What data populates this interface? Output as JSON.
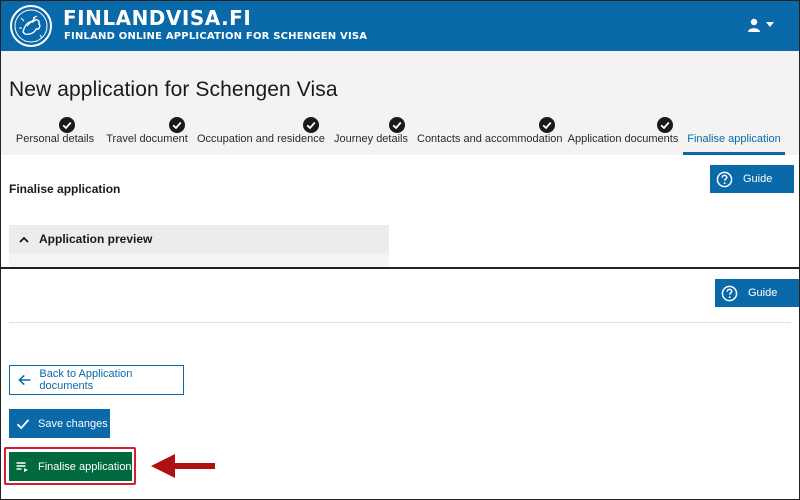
{
  "header": {
    "brand_title": "FINLANDVISA.FI",
    "brand_subtitle": "FINLAND ONLINE APPLICATION FOR SCHENGEN VISA",
    "user_icon": "user-icon",
    "menu_icon": "caret-down-icon",
    "background_color": "#0a69a9"
  },
  "page": {
    "title": "New application for Schengen Visa"
  },
  "steps": [
    {
      "label": "Personal details",
      "completed": true,
      "active": false
    },
    {
      "label": "Travel document",
      "completed": true,
      "active": false
    },
    {
      "label": "Occupation and residence",
      "completed": true,
      "active": false
    },
    {
      "label": "Journey details",
      "completed": true,
      "active": false
    },
    {
      "label": "Contacts and accommodation",
      "completed": true,
      "active": false
    },
    {
      "label": "Application documents",
      "completed": true,
      "active": false
    },
    {
      "label": "Finalise application",
      "completed": false,
      "active": true
    }
  ],
  "top_panel": {
    "guide_label": "Guide",
    "section_title": "Finalise application",
    "accordion_title": "Application preview",
    "accordion_icon": "chevron-up-icon"
  },
  "bottom_panel": {
    "guide_label": "Guide",
    "back_label": "Back to Application documents",
    "back_icon": "arrow-left-icon",
    "save_label": "Save changes",
    "save_icon": "check-icon",
    "finalise_label": "Finalise application",
    "finalise_icon": "list-arrow-icon"
  },
  "colors": {
    "primary": "#0a69a9",
    "finalise": "#00693e",
    "highlight": "#d0202a",
    "annotation_arrow": "#b01010"
  }
}
